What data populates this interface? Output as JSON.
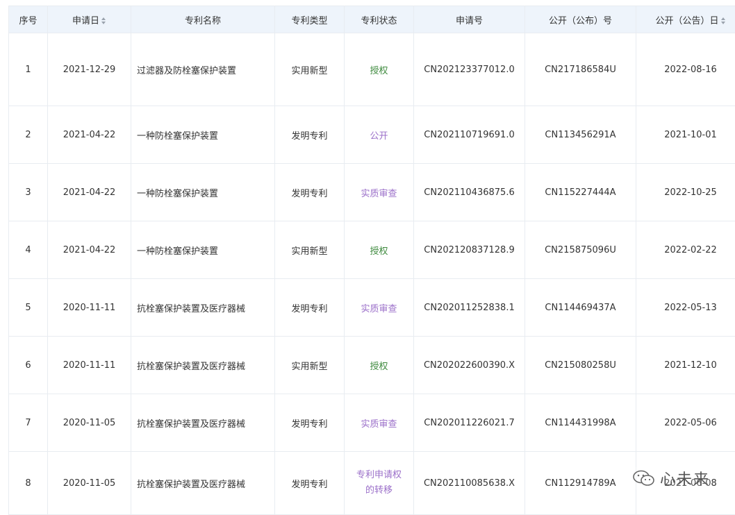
{
  "headers": [
    {
      "label": "序号",
      "sortable": false
    },
    {
      "label": "申请日",
      "sortable": true
    },
    {
      "label": "专利名称",
      "sortable": false
    },
    {
      "label": "专利类型",
      "sortable": false
    },
    {
      "label": "专利状态",
      "sortable": false
    },
    {
      "label": "申请号",
      "sortable": false
    },
    {
      "label": "公开（公布）号",
      "sortable": false
    },
    {
      "label": "公开（公告）日",
      "sortable": true
    }
  ],
  "status_colors": {
    "授权": "#3e8a3e",
    "公开": "#9b6fc9",
    "实质审查": "#9b6fc9",
    "专利申请权的转移": "#9b6fc9"
  },
  "rows": [
    {
      "no": "1",
      "date": "2021-12-29",
      "name": "过滤器及防栓塞保护装置",
      "type": "实用新型",
      "status": "授权",
      "app_no": "CN202123377012.0",
      "pub_no": "CN217186584U",
      "pub_date": "2022-08-16"
    },
    {
      "no": "2",
      "date": "2021-04-22",
      "name": "一种防栓塞保护装置",
      "type": "发明专利",
      "status": "公开",
      "app_no": "CN202110719691.0",
      "pub_no": "CN113456291A",
      "pub_date": "2021-10-01"
    },
    {
      "no": "3",
      "date": "2021-04-22",
      "name": "一种防栓塞保护装置",
      "type": "发明专利",
      "status": "实质审查",
      "app_no": "CN202110436875.6",
      "pub_no": "CN115227444A",
      "pub_date": "2022-10-25"
    },
    {
      "no": "4",
      "date": "2021-04-22",
      "name": "一种防栓塞保护装置",
      "type": "实用新型",
      "status": "授权",
      "app_no": "CN202120837128.9",
      "pub_no": "CN215875096U",
      "pub_date": "2022-02-22"
    },
    {
      "no": "5",
      "date": "2020-11-11",
      "name": "抗栓塞保护装置及医疗器械",
      "type": "发明专利",
      "status": "实质审查",
      "app_no": "CN202011252838.1",
      "pub_no": "CN114469437A",
      "pub_date": "2022-05-13"
    },
    {
      "no": "6",
      "date": "2020-11-11",
      "name": "抗栓塞保护装置及医疗器械",
      "type": "实用新型",
      "status": "授权",
      "app_no": "CN202022600390.X",
      "pub_no": "CN215080258U",
      "pub_date": "2021-12-10"
    },
    {
      "no": "7",
      "date": "2020-11-05",
      "name": "抗栓塞保护装置及医疗器械",
      "type": "发明专利",
      "status": "实质审查",
      "app_no": "CN202011226021.7",
      "pub_no": "CN114431998A",
      "pub_date": "2022-05-06"
    },
    {
      "no": "8",
      "date": "2020-11-05",
      "name": "抗栓塞保护装置及医疗器械",
      "type": "发明专利",
      "status": "专利申请权的转移",
      "app_no": "CN202110085638.X",
      "pub_no": "CN112914789A",
      "pub_date": "2021-06-08"
    }
  ],
  "watermark": {
    "text": "心未来",
    "icon": "wechat-icon"
  }
}
